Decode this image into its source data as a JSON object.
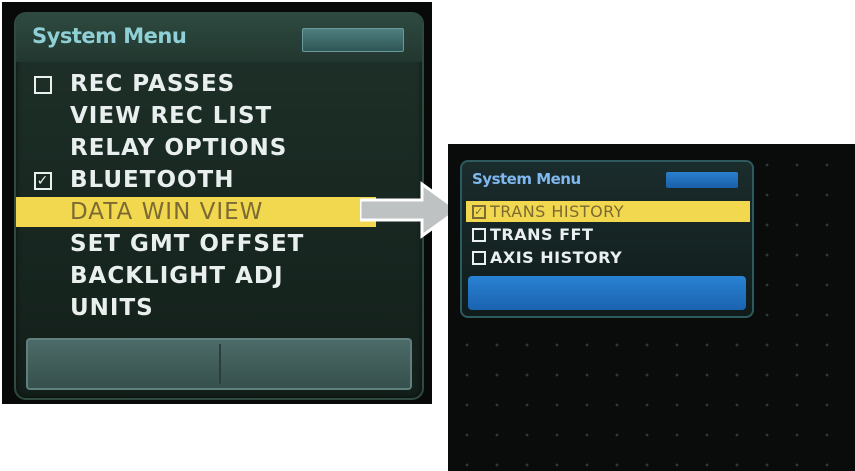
{
  "left_menu": {
    "title": "System Menu",
    "items": [
      {
        "label": "REC PASSES",
        "checkbox": "unchecked",
        "check_glyph": ""
      },
      {
        "label": "VIEW REC LIST"
      },
      {
        "label": "RELAY OPTIONS"
      },
      {
        "label": "BLUETOOTH",
        "checkbox": "checked",
        "check_glyph": "✓"
      },
      {
        "label": "DATA WIN VIEW",
        "selected": true
      },
      {
        "label": "SET GMT OFFSET"
      },
      {
        "label": "BACKLIGHT ADJ"
      },
      {
        "label": "UNITS"
      }
    ]
  },
  "right_menu": {
    "title": "System Menu",
    "items": [
      {
        "label": "TRANS HISTORY",
        "checkbox": "checked",
        "check_glyph": "✓",
        "selected": true
      },
      {
        "label": "TRANS FFT",
        "checkbox": "unchecked",
        "check_glyph": ""
      },
      {
        "label": "AXIS HISTORY",
        "checkbox": "unchecked",
        "check_glyph": ""
      }
    ]
  },
  "colors": {
    "highlight": "#f2d84e",
    "left_title": "#8fd0d6",
    "right_title": "#7fb7ef",
    "right_accent": "#2a7fce"
  },
  "icons": {
    "arrow": "right-arrow-icon"
  }
}
